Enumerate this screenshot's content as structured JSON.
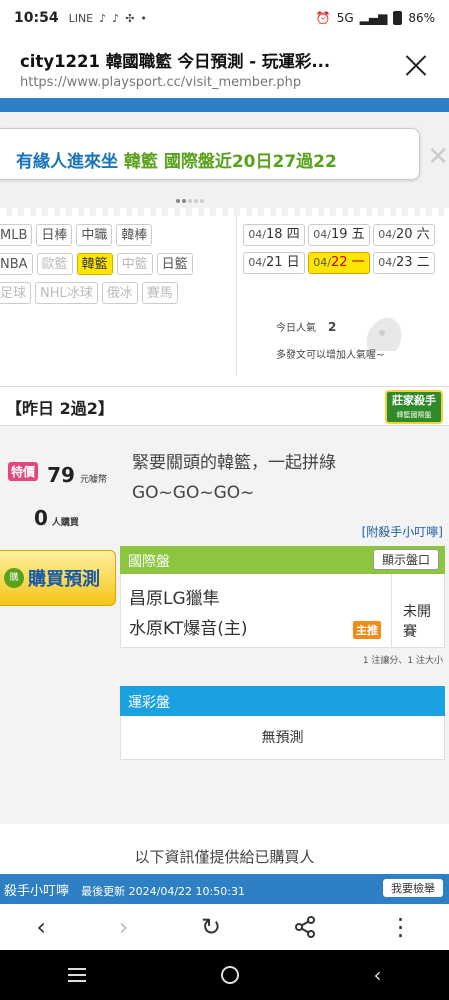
{
  "status_bar": {
    "time": "10:54",
    "notif_icons": [
      "LINE",
      "TikTok",
      "TikTok",
      "Pinwheel",
      "•"
    ],
    "network": "5G",
    "battery": "86%"
  },
  "browser": {
    "title": "city1221 韓國職籃 今日預測 - 玩運彩...",
    "url": "https://www.playsport.cc/visit_member.php"
  },
  "notice": {
    "part1": "有緣人進來坐",
    "part2": "韓籃 國際盤近20日27過22"
  },
  "leagues": {
    "row1": [
      "MLB",
      "日棒",
      "中職",
      "韓棒"
    ],
    "row2": [
      "NBA",
      "歐籃",
      "韓籃",
      "中籃",
      "日籃"
    ],
    "row3": [
      "足球",
      "NHL冰球",
      "俄冰",
      "賽馬"
    ]
  },
  "dates": [
    {
      "d": "04/",
      "v": "18 四"
    },
    {
      "d": "04/",
      "v": "19 五"
    },
    {
      "d": "04/",
      "v": "20 六"
    },
    {
      "d": "04/",
      "v": "21 日"
    },
    {
      "d": "04/",
      "v": "22 一"
    },
    {
      "d": "04/",
      "v": "23 二"
    }
  ],
  "popularity": {
    "label": "今日人氣",
    "value": "2",
    "hint": "多發文可以增加人氣喔~"
  },
  "yesterday": "【昨日 2過2】",
  "badge": {
    "main": "莊家殺手",
    "sub": "韓籃國際盤"
  },
  "pricing": {
    "special": "特價",
    "price": "79",
    "price_unit": "元噱幣",
    "buyers": "0",
    "buyers_unit": "人購買",
    "buy_button": "購買預測",
    "buy_icon": "購"
  },
  "pitch": {
    "line1": "緊要關頭的韓籃，一起拼綠",
    "line2": "GO~GO~GO~"
  },
  "tips_link": "[附殺手小叮嚀]",
  "intl": {
    "header": "國際盤",
    "show_button": "顯示盤口",
    "team1": "昌原LG獵隼",
    "team2": "水原KT爆音(主)",
    "host_tag": "主推",
    "status": "未開賽",
    "note": "1 注讓分、1 注大小"
  },
  "lottery": {
    "header": "運彩盤",
    "body": "無預測"
  },
  "info": "以下資訊僅提供給已購買人",
  "killer_bar": {
    "title": "殺手小叮嚀",
    "updated": "最後更新 2024/04/22 10:50:31",
    "report": "我要檢舉"
  },
  "toolbar": {
    "back": "‹",
    "forward": "›",
    "reload": "↻",
    "share": "share",
    "more": "⋮"
  }
}
